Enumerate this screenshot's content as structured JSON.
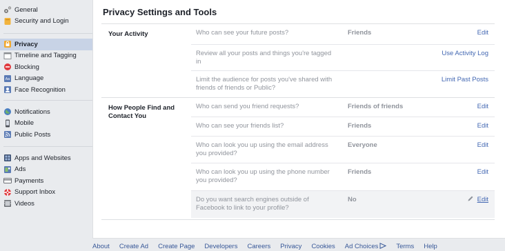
{
  "sidebar": {
    "group1": [
      {
        "label": "General",
        "icon": "gears-icon"
      },
      {
        "label": "Security and Login",
        "icon": "shield-icon"
      }
    ],
    "group2": [
      {
        "label": "Privacy",
        "icon": "lock-icon",
        "active": true
      },
      {
        "label": "Timeline and Tagging",
        "icon": "timeline-icon"
      },
      {
        "label": "Blocking",
        "icon": "block-icon"
      },
      {
        "label": "Language",
        "icon": "language-icon"
      },
      {
        "label": "Face Recognition",
        "icon": "face-recognition-icon"
      }
    ],
    "group3": [
      {
        "label": "Notifications",
        "icon": "globe-icon"
      },
      {
        "label": "Mobile",
        "icon": "mobile-icon"
      },
      {
        "label": "Public Posts",
        "icon": "rss-icon"
      }
    ],
    "group4": [
      {
        "label": "Apps and Websites",
        "icon": "apps-icon"
      },
      {
        "label": "Ads",
        "icon": "ads-icon"
      },
      {
        "label": "Payments",
        "icon": "payments-icon"
      },
      {
        "label": "Support Inbox",
        "icon": "lifebuoy-icon"
      },
      {
        "label": "Videos",
        "icon": "videos-icon"
      }
    ]
  },
  "main": {
    "title": "Privacy Settings and Tools",
    "sections": [
      {
        "label": "Your Activity",
        "rows": [
          {
            "question": "Who can see your future posts?",
            "value": "Friends",
            "action": "Edit"
          },
          {
            "question": "Review all your posts and things you're tagged in",
            "value": "",
            "action": "Use Activity Log"
          },
          {
            "question": "Limit the audience for posts you've shared with friends of friends or Public?",
            "value": "",
            "action": "Limit Past Posts"
          }
        ]
      },
      {
        "label": "How People Find and Contact You",
        "rows": [
          {
            "question": "Who can send you friend requests?",
            "value": "Friends of friends",
            "action": "Edit"
          },
          {
            "question": "Who can see your friends list?",
            "value": "Friends",
            "action": "Edit"
          },
          {
            "question": "Who can look you up using the email address you provided?",
            "value": "Everyone",
            "action": "Edit"
          },
          {
            "question": "Who can look you up using the phone number you provided?",
            "value": "Friends",
            "action": "Edit"
          },
          {
            "question": "Do you want search engines outside of Facebook to link to your profile?",
            "value": "No",
            "action": "Edit"
          }
        ]
      }
    ]
  },
  "footer": {
    "links": [
      "About",
      "Create Ad",
      "Create Page",
      "Developers",
      "Careers",
      "Privacy",
      "Cookies",
      "Ad Choices",
      "Terms",
      "Help"
    ]
  },
  "colors": {
    "link": "#4267b2",
    "active_bg": "#c8d3e6",
    "muted": "#90949c"
  }
}
